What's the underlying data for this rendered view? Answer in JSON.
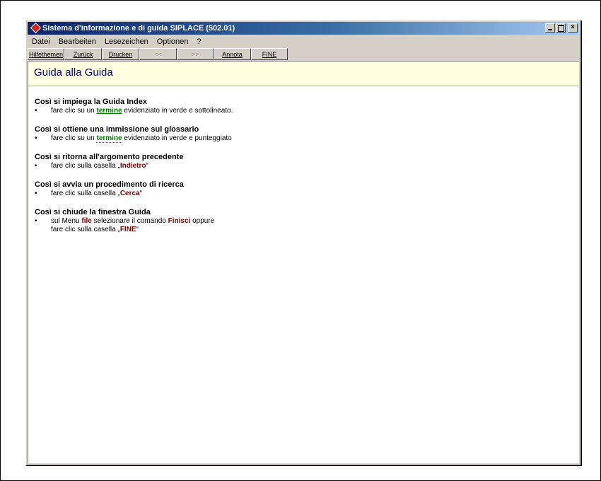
{
  "window": {
    "title": "Sistema d'informazione e di guida SIPLACE (502.01)",
    "minimize_label": "_",
    "maximize_label": "□",
    "close_label": "×"
  },
  "menu": [
    "Datei",
    "Bearbeiten",
    "Lesezeichen",
    "Optionen",
    "?"
  ],
  "toolbar": {
    "topics": "Hilfethemen",
    "back": "Zurück",
    "print": "Drucken",
    "prev": "<<",
    "next": ">>",
    "annotate": "Annota",
    "end": "FINE"
  },
  "page": {
    "title": "Guida alla Guida"
  },
  "sections": [
    {
      "heading": "Così si impiega la Guida Index",
      "bullet": "•",
      "line_pre": "fare clic su un ",
      "line_em": "termine",
      "line_post": " evidenziato in verde e sottolineato."
    },
    {
      "heading": "Così si ottiene una immissione sul glossario",
      "bullet": "•",
      "line_pre": "fare clic su un ",
      "line_em": "termine",
      "line_post": " evidenziato in verde e punteggiato"
    },
    {
      "heading": "Così si ritorna all'argomento precedente",
      "bullet": "•",
      "line_pre": "fare clic sulla casella „",
      "line_em": "Indietro",
      "line_post": "“"
    },
    {
      "heading": "Così si avvia un procedimento di ricerca",
      "bullet": "•",
      "line_pre": "fare clic sulla casella „",
      "line_em": "Cerca",
      "line_post": "“"
    },
    {
      "heading": "Così si chiude la finestra Guida",
      "bullet": "•",
      "line_pre": "sul Menu ",
      "line_em": "file",
      "line_mid": " selezionare il comando ",
      "line_em2": "Finisci",
      "line_post": " oppure",
      "line2_pre": "fare clic sulla casella „",
      "line2_em": "FINE",
      "line2_post": "“"
    }
  ],
  "colors": {
    "title_blue": "#000080",
    "link_green": "#008000",
    "keyword_red": "#800000",
    "header_band": "#ffffe1"
  }
}
